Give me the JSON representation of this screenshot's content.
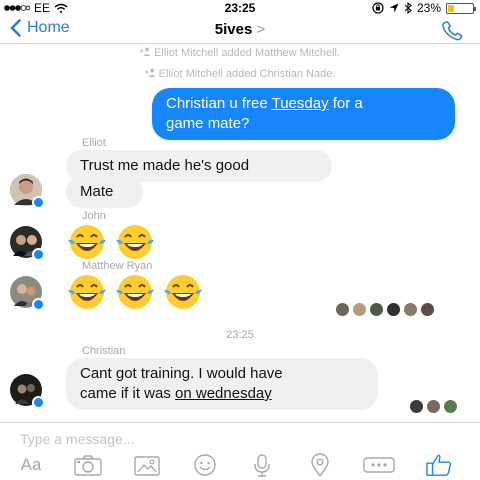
{
  "status_bar": {
    "carrier": "EE",
    "time": "23:25",
    "battery": "23%",
    "battery_level": 0.23
  },
  "nav": {
    "back_label": "Home",
    "title": "5ives",
    "title_chevron": ">"
  },
  "system_messages": [
    "Elliot Mitchell added Matthew Mitchell.",
    "Elliot Mitchell added Christian Nade."
  ],
  "outgoing": {
    "line1": "Christian u free ",
    "link": "Tuesday",
    "line1_end": " for a",
    "line2": "game mate?"
  },
  "elliot": {
    "sender": "Elliot",
    "msg1": "Trust me made he's good",
    "msg2": "Mate"
  },
  "john": {
    "sender": "John"
  },
  "matthew": {
    "sender": "Matthew Ryan"
  },
  "time_separator": "23:25",
  "christian": {
    "sender": "Christian",
    "line1": "Cant got training. I would have",
    "line2_pre": "came if it was ",
    "line2_link": "on wednesday"
  },
  "compose": {
    "placeholder": "Type a message...",
    "aa_label": "Aa"
  },
  "colors": {
    "accent": "#1785fb",
    "incoming_bubble": "#f0f0f0",
    "nav_blue": "#2a7ae2"
  },
  "icons": {
    "toolbar": [
      "camera-icon",
      "photo-icon",
      "emoji-icon",
      "microphone-icon",
      "location-icon",
      "more-icon",
      "like-icon"
    ]
  }
}
